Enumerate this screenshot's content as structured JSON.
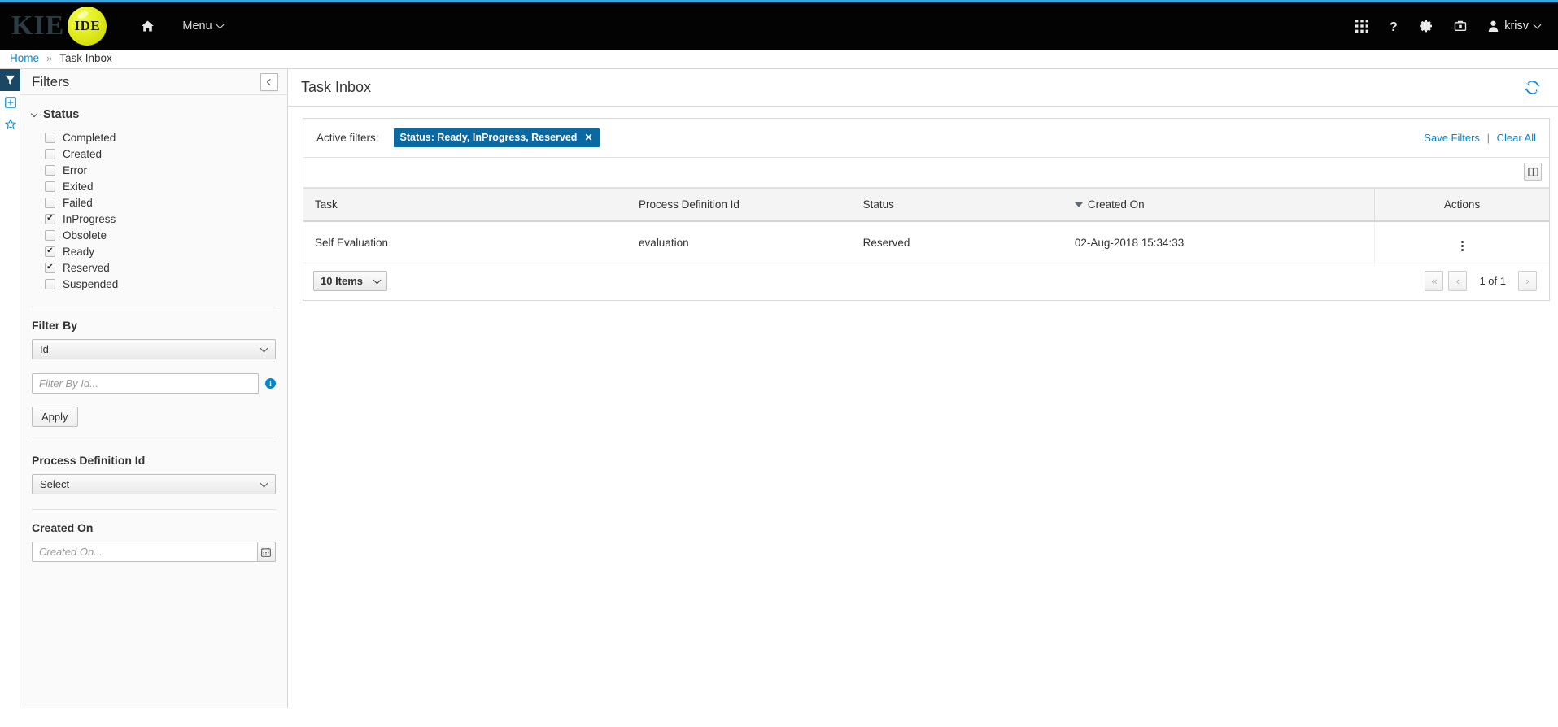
{
  "accent_color": "#39a5dc",
  "link_color": "#0088ce",
  "chip_color": "#0a68a3",
  "masthead": {
    "brand_primary": "KIE",
    "brand_secondary": "IDE",
    "home_icon": "home-icon",
    "menu_label": "Menu",
    "icons": [
      {
        "name": "apps-grid-icon",
        "glyph": "grid"
      },
      {
        "name": "help-question-icon",
        "glyph": "?"
      },
      {
        "name": "settings-gear-icon",
        "glyph": "gear"
      },
      {
        "name": "toolbox-icon",
        "glyph": "toolbox"
      }
    ],
    "user_name": "krisv"
  },
  "breadcrumb": {
    "home": "Home",
    "separator": "»",
    "current": "Task Inbox"
  },
  "rail": {
    "items": [
      {
        "name": "rail-filter-icon",
        "active": true
      },
      {
        "name": "rail-add-icon",
        "active": false
      },
      {
        "name": "rail-star-icon",
        "active": false
      }
    ]
  },
  "filters": {
    "panel_title": "Filters",
    "collapse_icon": "chevron-left-icon",
    "status": {
      "title": "Status",
      "options": [
        {
          "label": "Completed",
          "checked": false
        },
        {
          "label": "Created",
          "checked": false
        },
        {
          "label": "Error",
          "checked": false
        },
        {
          "label": "Exited",
          "checked": false
        },
        {
          "label": "Failed",
          "checked": false
        },
        {
          "label": "InProgress",
          "checked": true
        },
        {
          "label": "Obsolete",
          "checked": false
        },
        {
          "label": "Ready",
          "checked": true
        },
        {
          "label": "Reserved",
          "checked": true
        },
        {
          "label": "Suspended",
          "checked": false
        }
      ]
    },
    "filter_by": {
      "title": "Filter By",
      "select_value": "Id",
      "input_placeholder": "Filter By Id...",
      "input_value": "",
      "info_icon": "info-icon",
      "apply_label": "Apply"
    },
    "process_definition": {
      "title": "Process Definition Id",
      "select_value": "Select"
    },
    "created_on": {
      "title": "Created On",
      "input_placeholder": "Created On...",
      "input_value": "",
      "calendar_icon": "calendar-icon"
    }
  },
  "main": {
    "title": "Task Inbox",
    "refresh_icon": "refresh-icon",
    "active_filters": {
      "label": "Active filters:",
      "chips": [
        {
          "text": "Status: Ready, InProgress, Reserved",
          "close": "✕"
        }
      ],
      "save_filters": "Save Filters",
      "pipe": "|",
      "clear_all": "Clear All"
    },
    "columns_icon": "columns-settings-icon",
    "table": {
      "columns": [
        "Task",
        "Process Definition Id",
        "Status",
        "Created On",
        "Actions"
      ],
      "sorted_column": "Created On",
      "sort_direction": "desc",
      "rows": [
        {
          "task": "Self Evaluation",
          "process_definition_id": "evaluation",
          "status": "Reserved",
          "created_on": "02-Aug-2018 15:34:33",
          "actions_icon": "kebab-menu-icon"
        }
      ]
    },
    "pagination": {
      "page_size_label": "10 Items",
      "first_label": "«",
      "prev_label": "‹",
      "page_info": "1 of 1",
      "next_label": "›"
    }
  }
}
